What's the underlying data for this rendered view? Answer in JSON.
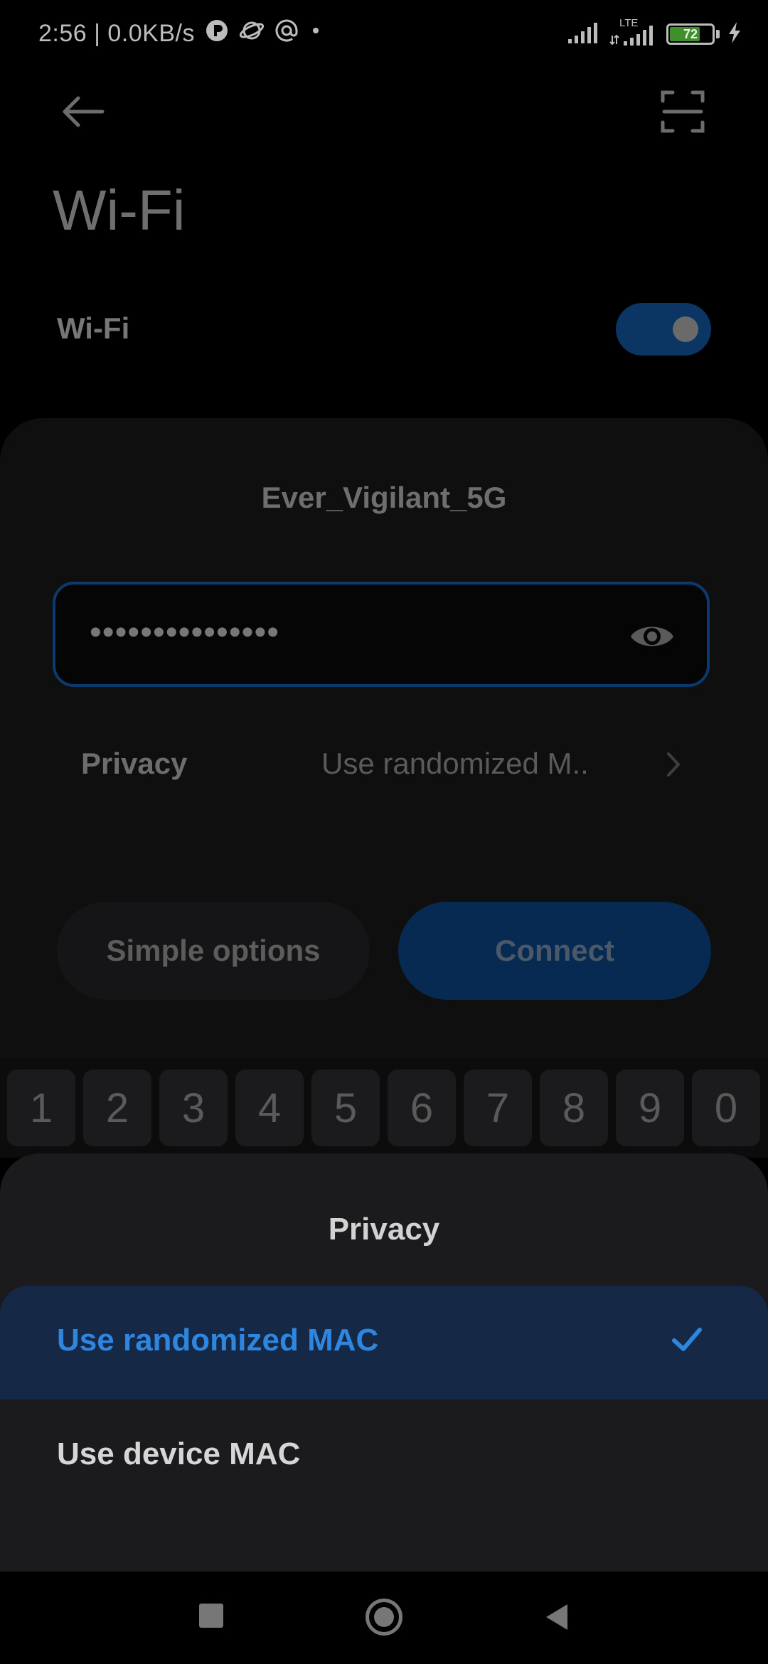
{
  "status_bar": {
    "time": "2:56 | 0.0KB/s",
    "network_type": "LTE",
    "battery_level": "72",
    "battery_fraction": 0.72
  },
  "header": {
    "title": "Wi-Fi",
    "back_icon": "arrow-left-icon",
    "scan_icon": "qr-scan-icon"
  },
  "wifi_toggle": {
    "label": "Wi-Fi",
    "state": "on",
    "accent": "#0b3563"
  },
  "dialog": {
    "network_name": "Ever_Vigilant_5G",
    "password_value": "•••••••••••••••",
    "privacy_label": "Privacy",
    "privacy_value": "Use randomized M..",
    "simple_options_label": "Simple options",
    "connect_label": "Connect"
  },
  "keyboard": {
    "keys": [
      "1",
      "2",
      "3",
      "4",
      "5",
      "6",
      "7",
      "8",
      "9",
      "0"
    ]
  },
  "privacy_sheet": {
    "title": "Privacy",
    "options": [
      {
        "label": "Use randomized MAC",
        "selected": true
      },
      {
        "label": "Use device MAC",
        "selected": false
      }
    ],
    "selected_color": "#2f86de"
  }
}
